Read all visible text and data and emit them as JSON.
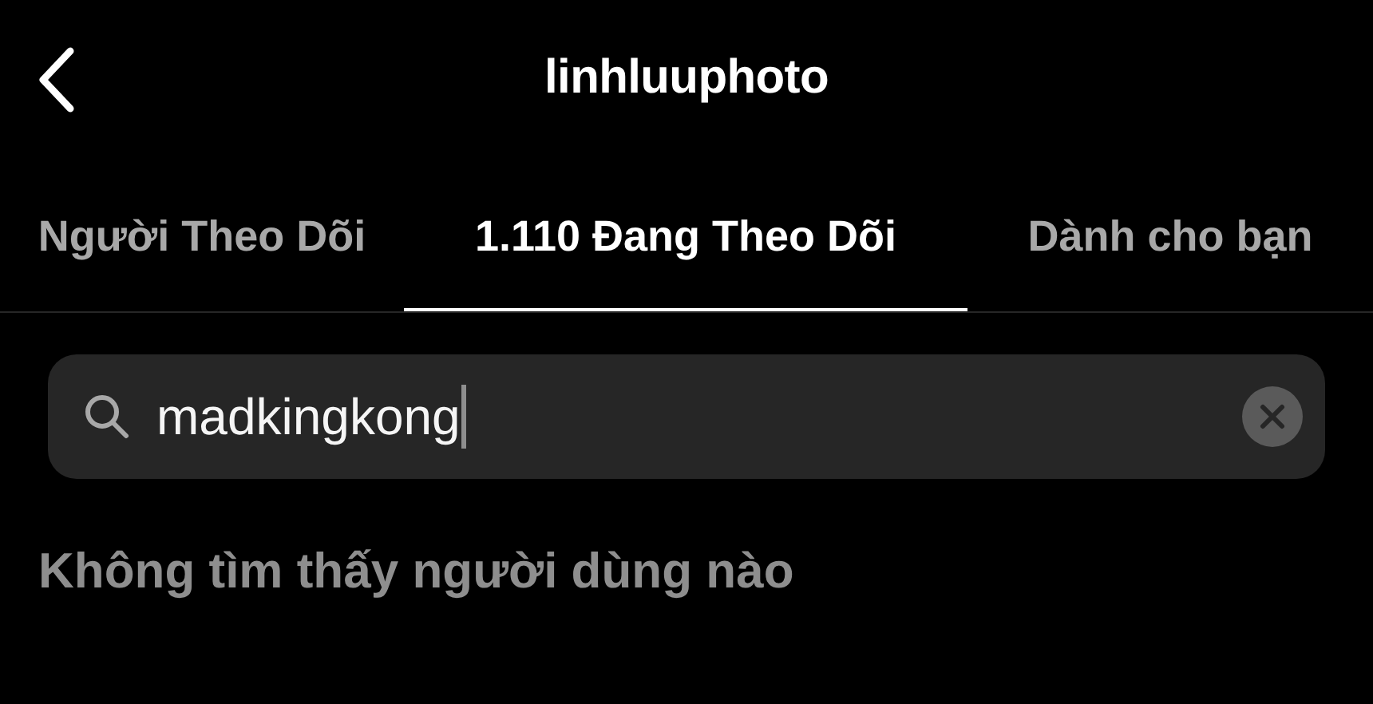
{
  "header": {
    "title": "linhluuphoto"
  },
  "tabs": [
    {
      "label": "Người Theo Dõi",
      "selected": false
    },
    {
      "label": "1.110 Đang Theo Dõi",
      "selected": true
    },
    {
      "label": "Dành cho bạn",
      "selected": false
    }
  ],
  "search": {
    "value": "madkingkong"
  },
  "empty_message": "Không tìm thấy người dùng nào"
}
